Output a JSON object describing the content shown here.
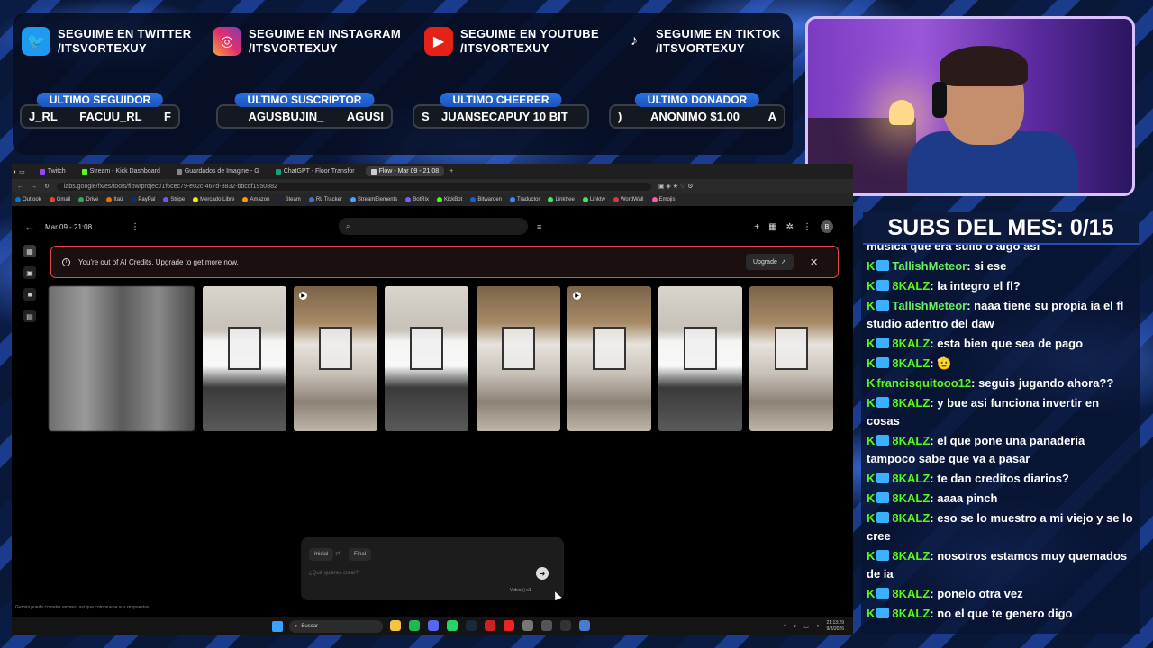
{
  "overlay": {
    "socials": [
      {
        "icon": "twitter-icon",
        "line1": "SEGUIME EN TWITTER",
        "line2": "/ITSVORTEXUY"
      },
      {
        "icon": "instagram-icon",
        "line1": "SEGUIME EN INSTAGRAM",
        "line2": "/ITSVORTEXUY"
      },
      {
        "icon": "youtube-icon",
        "line1": "SEGUIME EN YOUTUBE",
        "line2": "/ITSVORTEXUY"
      },
      {
        "icon": "tiktok-icon",
        "line1": "SEGUIME EN TIKTOK",
        "line2": "/ITSVORTEXUY"
      }
    ],
    "stats": [
      {
        "label": "ULTIMO SEGUIDOR",
        "left": "J_RL",
        "main": "FACUU_RL",
        "right": "F"
      },
      {
        "label": "ULTIMO SUSCRIPTOR",
        "left": "",
        "main": "AGUSBUJIN_",
        "right": "AGUSI"
      },
      {
        "label": "ULTIMO CHEERER",
        "left": "S",
        "main": "JUANSECAPUY 10 BIT",
        "right": ""
      },
      {
        "label": "ULTIMO DONADOR",
        "left": ")",
        "main": "ANONIMO $1.00",
        "right": "A"
      }
    ],
    "subs_title": "SUBS DEL MES: 0/15"
  },
  "chat": [
    {
      "user": "",
      "text": "musica que era sulio o algo asi",
      "partial": true
    },
    {
      "user": "TallishMeteor",
      "text": ": si ese"
    },
    {
      "user": "8KALZ",
      "text": ": la integro el fl?"
    },
    {
      "user": "TallishMeteor",
      "text": ": naaa tiene su propia ia el fl studio adentro del daw"
    },
    {
      "user": "8KALZ",
      "text": ": esta bien que sea de pago"
    },
    {
      "user": "8KALZ",
      "text": ": 🫡"
    },
    {
      "user": "francisquitooo12",
      "text": ": seguis jugando ahora??"
    },
    {
      "user": "8KALZ",
      "text": ": y bue asi funciona invertir en cosas"
    },
    {
      "user": "8KALZ",
      "text": ": el que pone una panaderia tampoco sabe que va a pasar"
    },
    {
      "user": "8KALZ",
      "text": ": te dan creditos diarios?"
    },
    {
      "user": "8KALZ",
      "text": ": aaaa pinch"
    },
    {
      "user": "8KALZ",
      "text": ": eso se lo muestro a mi viejo y se lo cree"
    },
    {
      "user": "8KALZ",
      "text": ": nosotros estamos muy quemados de ia"
    },
    {
      "user": "8KALZ",
      "text": ": ponelo otra vez"
    },
    {
      "user": "8KALZ",
      "text": ": no el que te genero digo"
    }
  ],
  "browser": {
    "tabs": [
      {
        "label": "Twitch",
        "color": "#9146ff"
      },
      {
        "label": "Stream - Kick Dashboard",
        "color": "#53fc18"
      },
      {
        "label": "Guardados de Imagine - G",
        "color": "#888888"
      },
      {
        "label": "ChatGPT - Floor Transfor",
        "color": "#10a37f"
      },
      {
        "label": "Flow - Mar 09 - 21:08",
        "color": "#cccccc",
        "active": true
      }
    ],
    "url": "labs.google/fx/es/tools/flow/project/1f6cec79-e02c-467d-8832-bbcdf1950882",
    "bookmarks": [
      "Outlook",
      "Gmail",
      "Drive",
      "Itaú",
      "PayPal",
      "Stripe",
      "Mercado Libre",
      "Amazon",
      "Steam",
      "RL Tracker",
      "StreamElements",
      "BotRix",
      "KickBot",
      "Bitwarden",
      "Traductor",
      "Linktree",
      "Linktw",
      "WordWall",
      "Emojis"
    ]
  },
  "flow": {
    "project_title": "Mar 09 - 21:08",
    "alert_message": "You're out of AI Credits. Upgrade to get more now.",
    "upgrade_label": "Upgrade",
    "composer": {
      "inicial": "Inicial",
      "final": "Final",
      "placeholder": "¿Qué quieres crear?",
      "mode": "Video  ▯  x1"
    },
    "disclaimer": "Gemini puede cometer errores, así que comprueba sus respuestas"
  },
  "taskbar": {
    "search": "Buscar",
    "time": "21:13:29",
    "date": "9/3/2026"
  }
}
